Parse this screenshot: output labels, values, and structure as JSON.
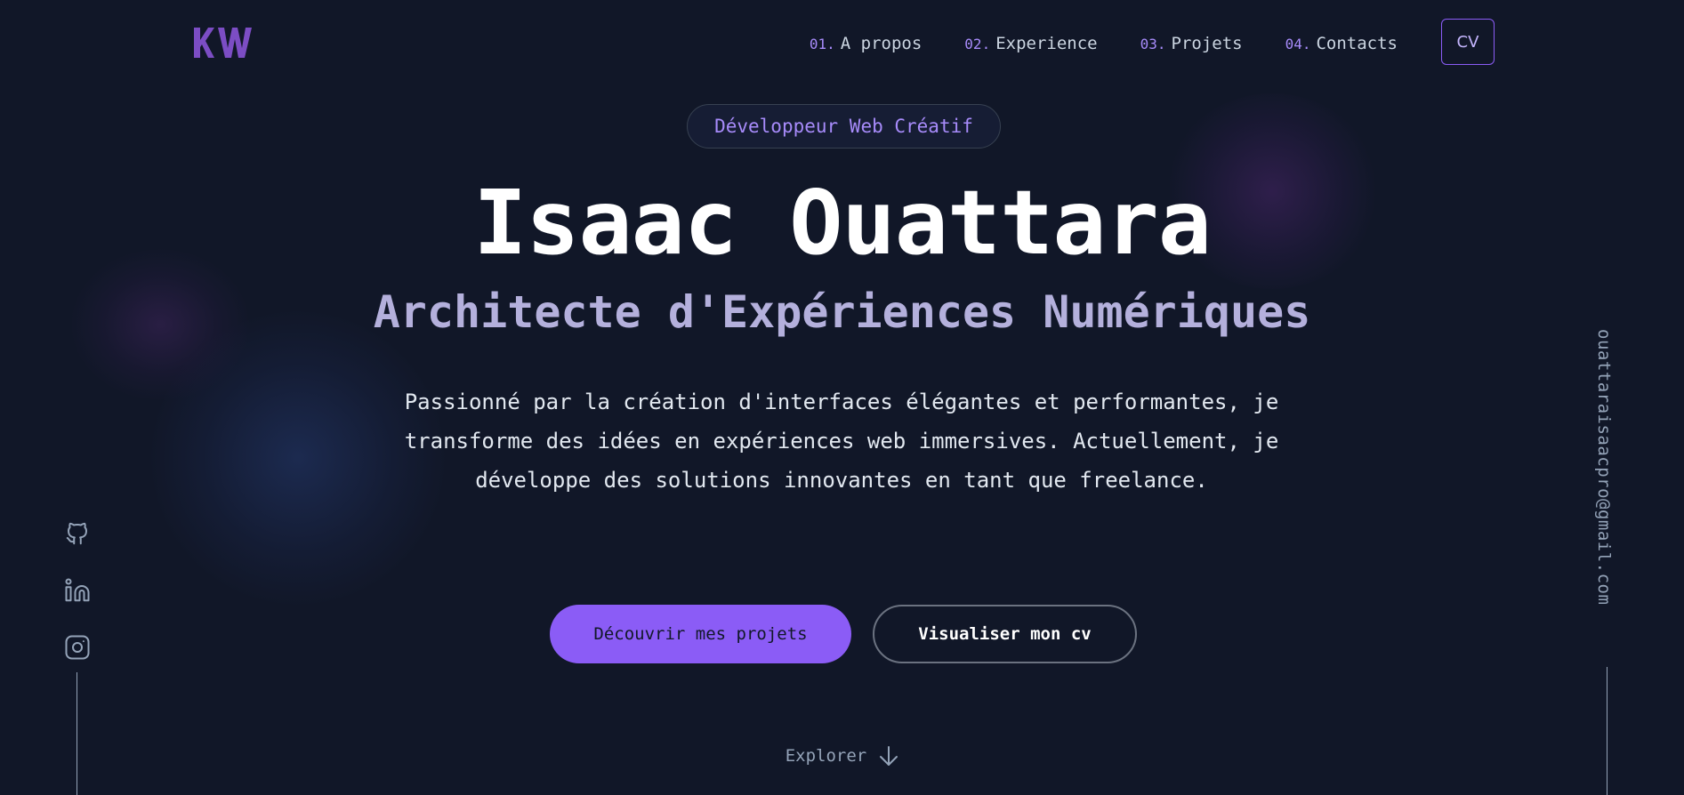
{
  "header": {
    "logo_text": "KW",
    "nav": [
      {
        "num": "01.",
        "label": "A propos"
      },
      {
        "num": "02.",
        "label": "Experience"
      },
      {
        "num": "03.",
        "label": "Projets"
      },
      {
        "num": "04.",
        "label": "Contacts"
      }
    ],
    "cv_label": "CV"
  },
  "hero": {
    "badge": "Développeur Web Créatif",
    "name": "Isaac Ouattara",
    "subtitle": "Architecte d'Expériences Numériques",
    "description": "Passionné par la création d'interfaces élégantes et performantes, je transforme des idées en expériences web immersives. Actuellement, je développe des solutions innovantes en tant que freelance.",
    "primary_button": "Découvrir mes projets",
    "secondary_button": "Visualiser mon cv",
    "explore_label": "Explorer"
  },
  "social": {
    "icons": [
      "github-icon",
      "linkedin-icon",
      "instagram-icon"
    ]
  },
  "email": "ouattaraisaacpro@gmail.com",
  "colors": {
    "background": "#111728",
    "accent": "#8b5cf6",
    "accent_light": "#a78bfa",
    "subtitle": "#b4b0dc"
  }
}
